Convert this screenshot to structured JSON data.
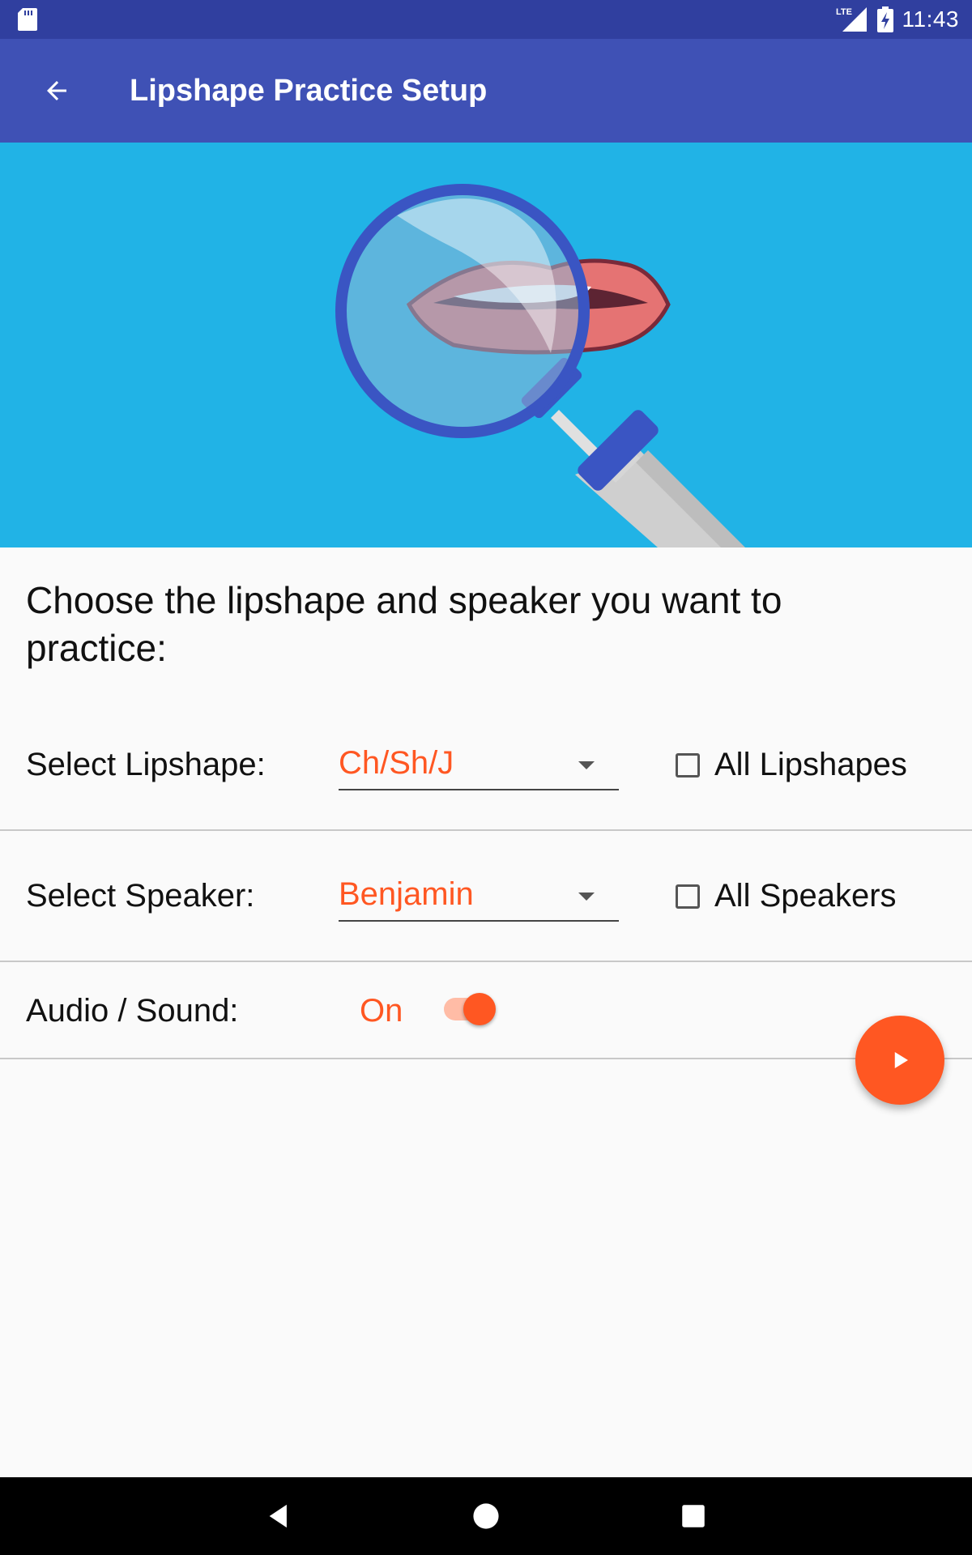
{
  "status_bar": {
    "network_label": "LTE",
    "time": "11:43",
    "icons": [
      "sd-card-icon",
      "lte-signal-icon",
      "battery-charging-icon"
    ]
  },
  "app_bar": {
    "back_icon": "arrow-left-icon",
    "title": "Lipshape Practice Setup"
  },
  "hero": {
    "illustration": "magnifying-glass-over-lips"
  },
  "prompt": "Choose the lipshape and speaker you want to practice:",
  "lipshape_row": {
    "label": "Select Lipshape:",
    "selected": "Ch/Sh/J",
    "checkbox_label": "All Lipshapes",
    "checkbox_checked": false
  },
  "speaker_row": {
    "label": "Select Speaker:",
    "selected": "Benjamin",
    "checkbox_label": "All Speakers",
    "checkbox_checked": false
  },
  "audio_row": {
    "label": "Audio / Sound:",
    "state_label": "On",
    "enabled": true
  },
  "fab": {
    "icon": "play-icon"
  },
  "nav_bar": {
    "icons": [
      "back-triangle-icon",
      "home-circle-icon",
      "recents-square-icon"
    ]
  },
  "colors": {
    "status_bar": "#303f9f",
    "app_bar": "#3f51b5",
    "hero_bg": "#21b3e6",
    "accent": "#ff5722",
    "toggle_track": "#ffbca6"
  }
}
